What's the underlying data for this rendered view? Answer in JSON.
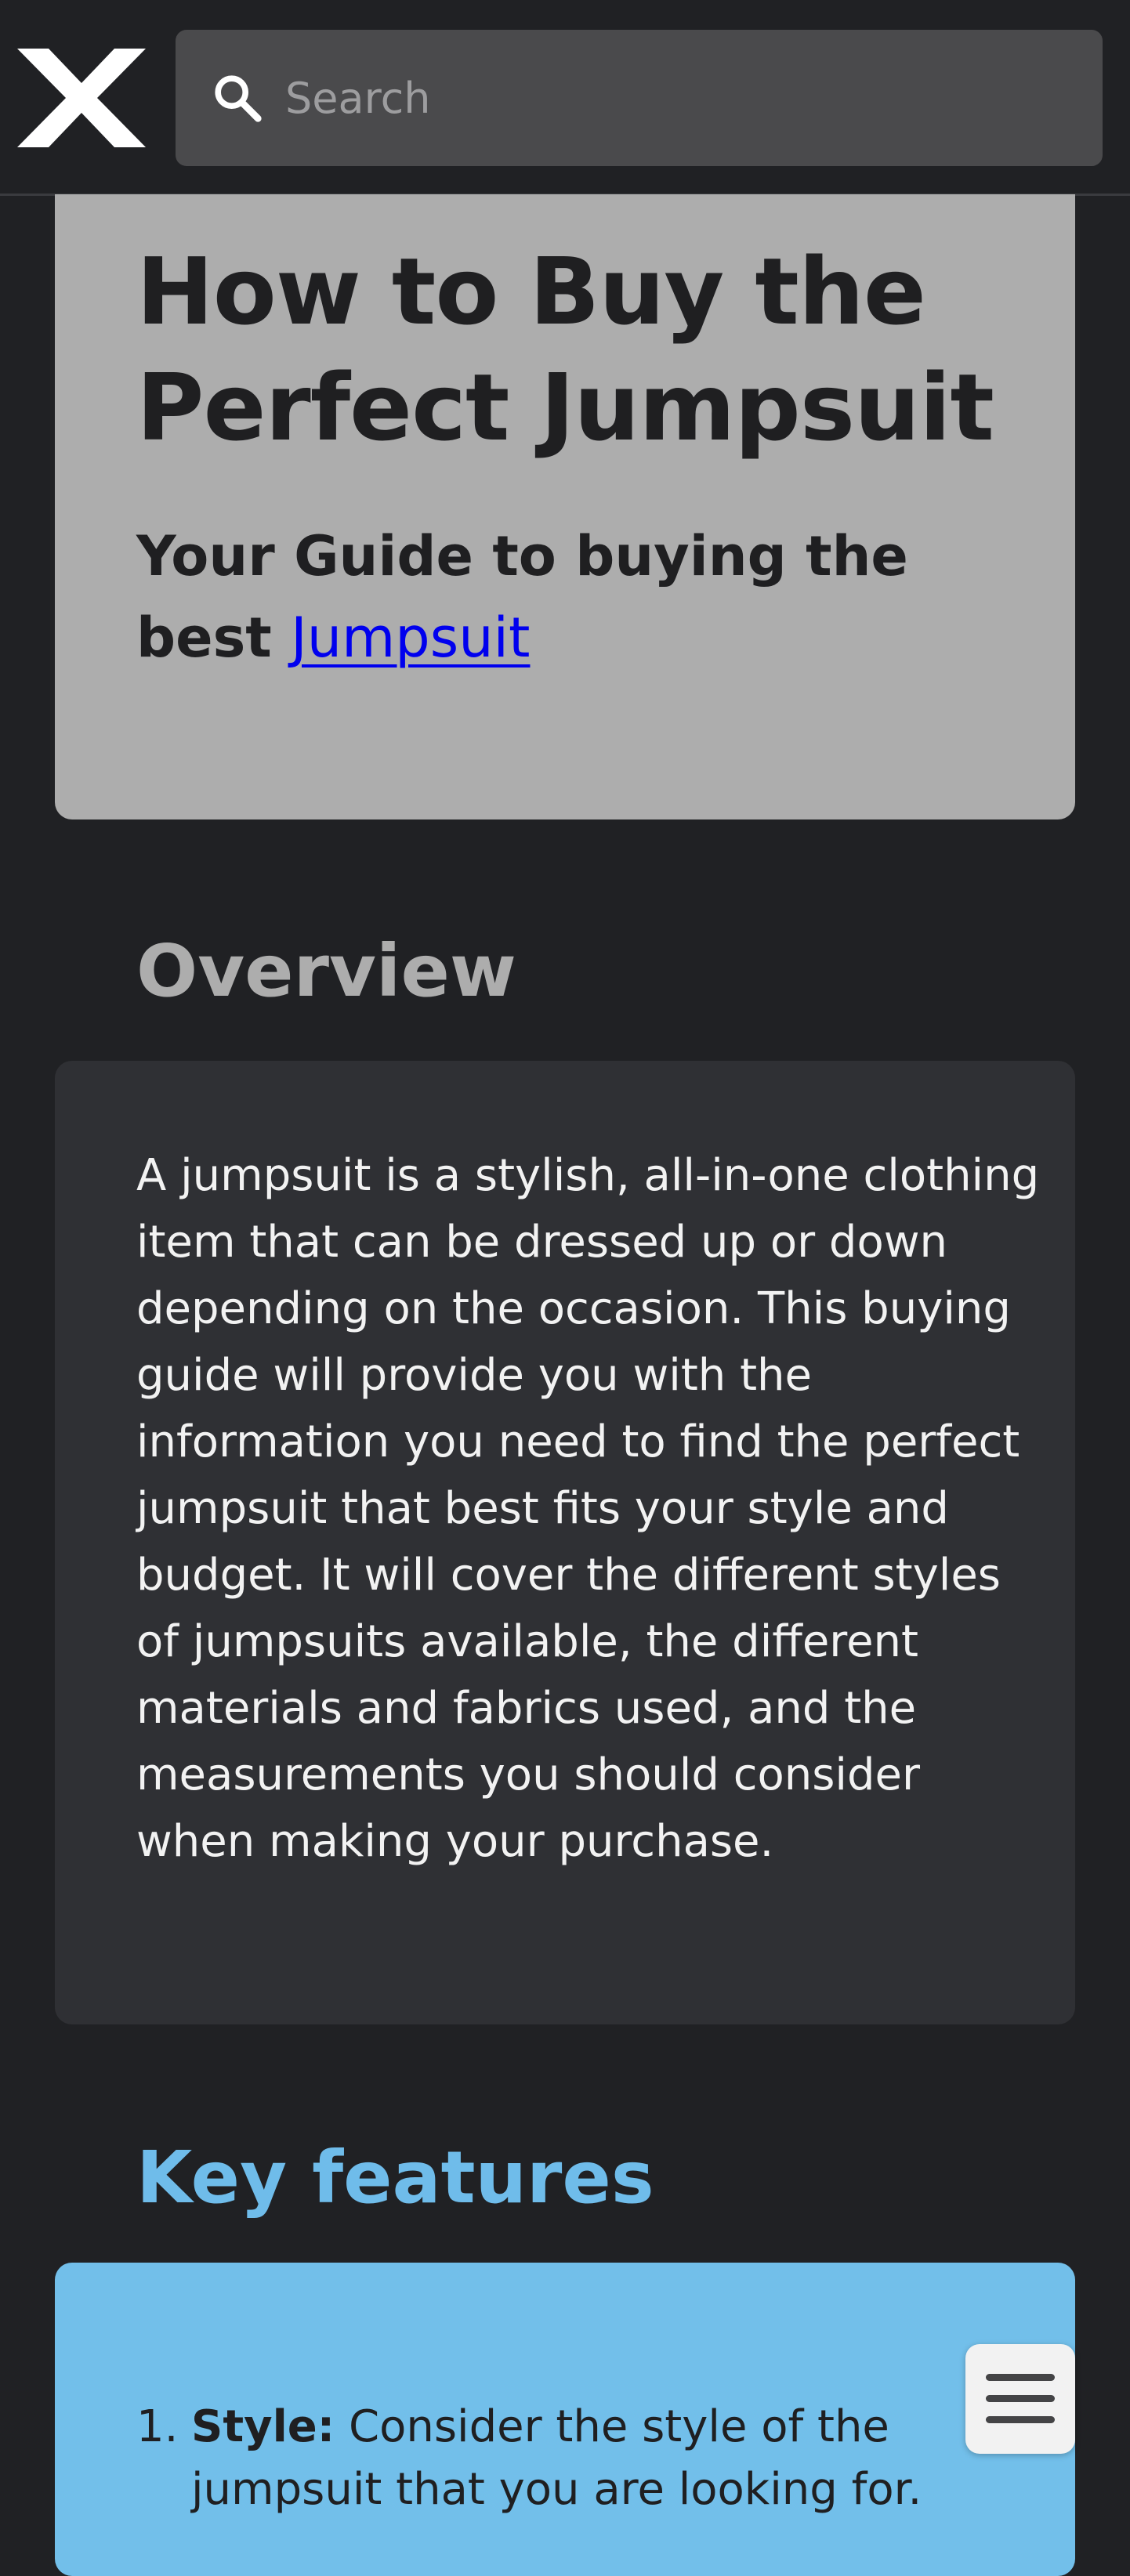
{
  "header": {
    "logo_alt": "X",
    "search": {
      "placeholder": "Search",
      "value": ""
    }
  },
  "hero": {
    "title": "How to Buy the Perfect Jumpsuit",
    "subtitle_prefix": "Your Guide to buying the best",
    "subtitle_link": "Jumpsuit"
  },
  "overview": {
    "heading": "Overview",
    "text": "A jumpsuit is a stylish, all-in-one clothing item that can be dressed up or down depending on the occasion. This buying guide will provide you with the information you need to find the perfect jumpsuit that best fits your style and budget. It will cover the different styles of jumpsuits available, the different materials and fabrics used, and the measurements you should consider when making your purchase."
  },
  "features": {
    "heading": "Key features",
    "items": [
      {
        "number": "1.",
        "term": "Style:",
        "text": "Consider the style of the jumpsuit that you are looking for."
      }
    ]
  },
  "colors": {
    "background": "#202124",
    "hero_card": "#adadad",
    "overview_card": "#2f3034",
    "features_accent": "#72bfea",
    "features_heading": "#6fbcea"
  },
  "icons": {
    "logo": "x-logo-icon",
    "search": "search-icon",
    "menu": "hamburger-menu-icon"
  }
}
